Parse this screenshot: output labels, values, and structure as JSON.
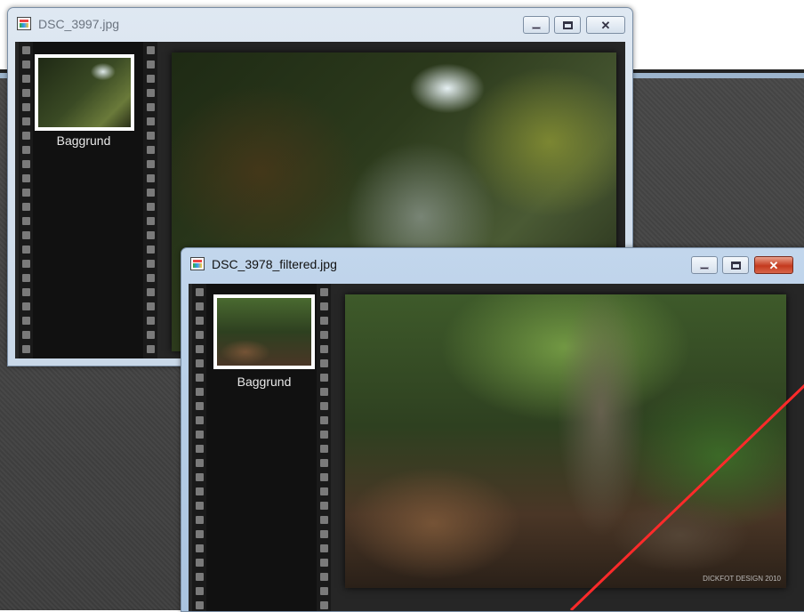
{
  "windows": {
    "back": {
      "title": "DSC_3997.jpg",
      "thumbnail_label": "Baggrund"
    },
    "front": {
      "title": "DSC_3978_filtered.jpg",
      "thumbnail_label": "Baggrund",
      "photo_credit": "DICKFOT DESIGN 2010"
    }
  },
  "icons": {
    "minimize": "minimize-icon",
    "maximize": "maximize-icon",
    "close": "close-icon",
    "file": "image-file-icon"
  },
  "colors": {
    "annotation_line": "#ff2a2a",
    "close_button_active": "#c43a1e"
  }
}
